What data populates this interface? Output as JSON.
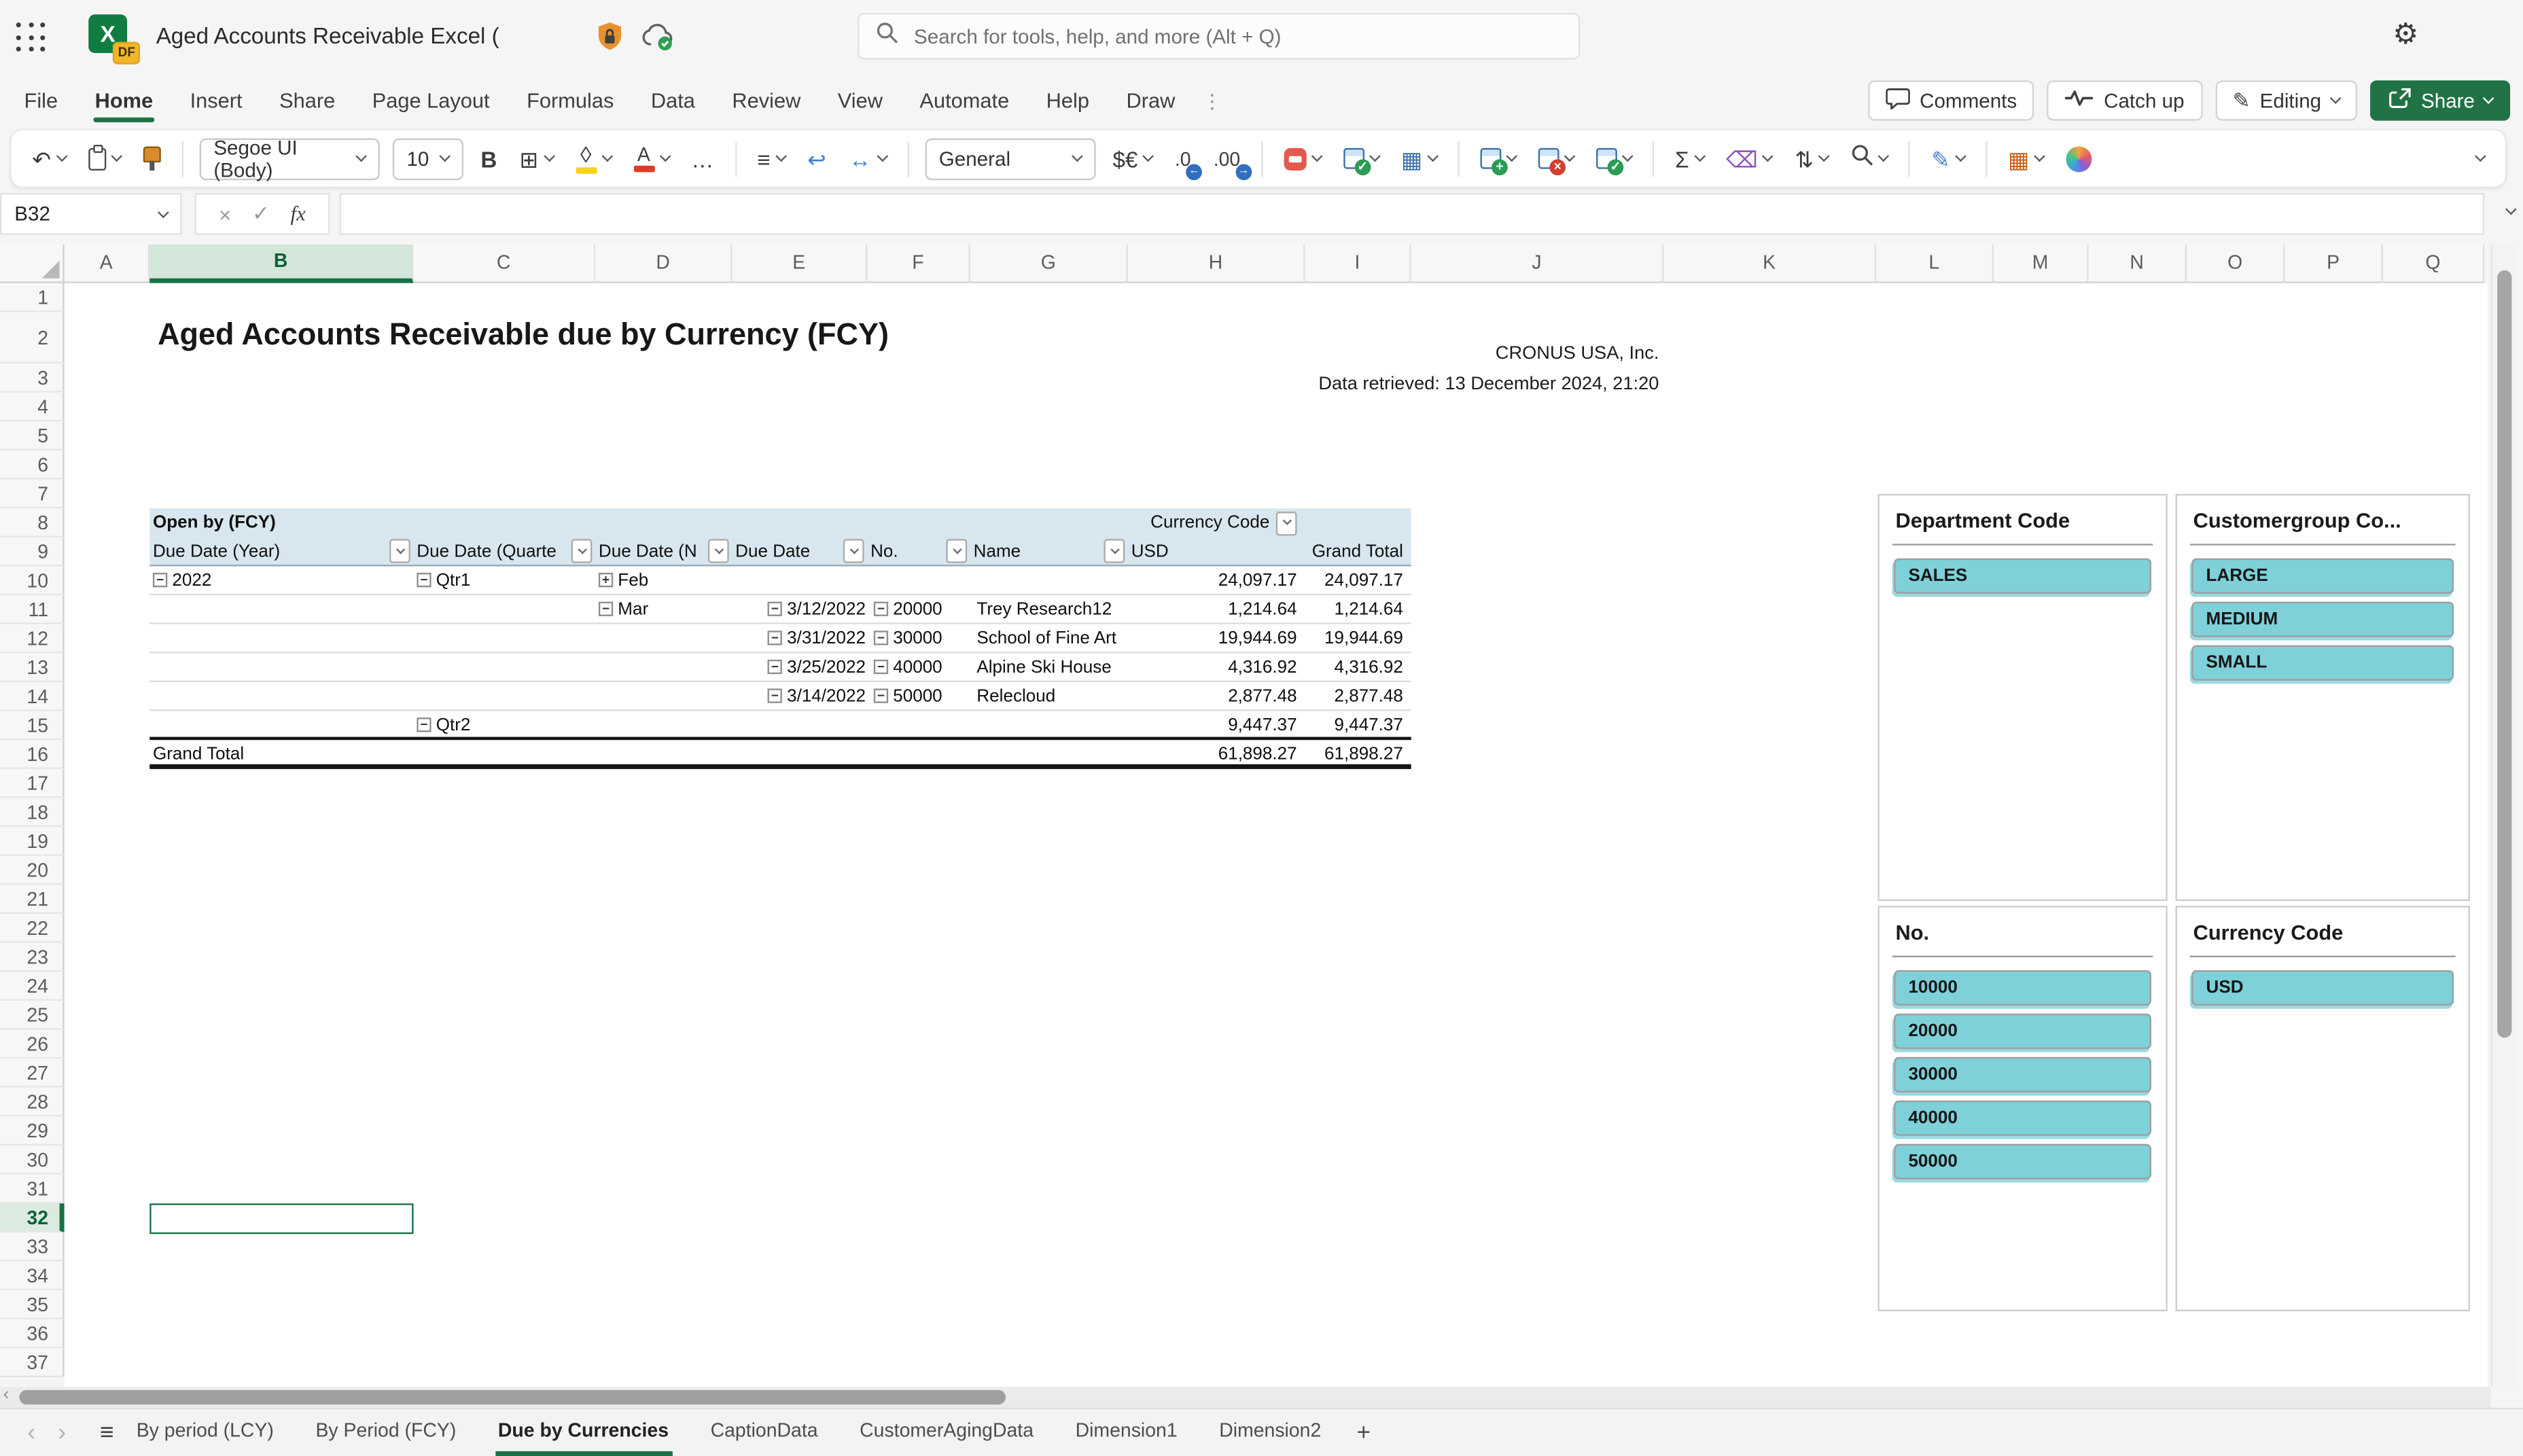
{
  "top_bar": {
    "title": "Aged Accounts Receivable Excel (",
    "file_badge": "DF",
    "search_placeholder": "Search for tools, help, and more (Alt + Q)"
  },
  "ribbon": {
    "tabs": [
      "File",
      "Home",
      "Insert",
      "Share",
      "Page Layout",
      "Formulas",
      "Data",
      "Review",
      "View",
      "Automate",
      "Help",
      "Draw"
    ],
    "active_tab": "Home",
    "comments_label": "Comments",
    "catch_up_label": "Catch up",
    "editing_label": "Editing",
    "share_label": "Share"
  },
  "toolbar": {
    "font_name": "Segoe UI (Body)",
    "font_size": "10",
    "number_format": "General"
  },
  "formula_bar": {
    "name_box": "B32",
    "formula": ""
  },
  "grid": {
    "columns": [
      "A",
      "B",
      "C",
      "D",
      "E",
      "F",
      "G",
      "H",
      "I",
      "J",
      "K",
      "L",
      "M",
      "N",
      "O",
      "P",
      "Q"
    ],
    "selected_column": "B",
    "row_count": 37,
    "selected_row": 32
  },
  "sheet": {
    "title": "Aged Accounts Receivable due by Currency (FCY)",
    "company": "CRONUS USA, Inc.",
    "retrieved": "Data retrieved: 13 December 2024, 21:20"
  },
  "pivot": {
    "title": "Open by (FCY)",
    "page_field": "Currency Code",
    "col_headers": [
      {
        "label": "Due Date (Year)",
        "dropdown": true
      },
      {
        "label": "Due Date (Quarte",
        "dropdown": true
      },
      {
        "label": "Due Date (N",
        "dropdown": true
      },
      {
        "label": "Due Date",
        "dropdown": true
      },
      {
        "label": "No.",
        "dropdown": true
      },
      {
        "label": "Name",
        "dropdown": true
      },
      {
        "label": "USD",
        "dropdown": false
      },
      {
        "label": "Grand Total",
        "dropdown": false
      }
    ],
    "rows": [
      {
        "b": "gray",
        "cells": [
          {
            "c": 0,
            "icon": "collapse",
            "t": "2022"
          },
          {
            "c": 1,
            "icon": "collapse",
            "t": "Qtr1"
          },
          {
            "c": 2,
            "icon": "expand",
            "t": "Feb"
          },
          {
            "c": 6,
            "t": "24,097.17",
            "a": "num"
          },
          {
            "c": 7,
            "t": "24,097.17",
            "a": "num"
          }
        ]
      },
      {
        "b": "gray",
        "cells": [
          {
            "c": 2,
            "icon": "collapse",
            "t": "Mar"
          },
          {
            "c": 3,
            "icon": "collapse",
            "t": "3/12/2022",
            "a": "r"
          },
          {
            "c": 4,
            "icon": "collapse",
            "t": "20000"
          },
          {
            "c": 5,
            "t": "Trey Research12"
          },
          {
            "c": 6,
            "t": "1,214.64",
            "a": "num"
          },
          {
            "c": 7,
            "t": "1,214.64",
            "a": "num"
          }
        ]
      },
      {
        "b": "gray",
        "cells": [
          {
            "c": 3,
            "icon": "collapse",
            "t": "3/31/2022",
            "a": "r"
          },
          {
            "c": 4,
            "icon": "collapse",
            "t": "30000"
          },
          {
            "c": 5,
            "t": "School of Fine Art"
          },
          {
            "c": 6,
            "t": "19,944.69",
            "a": "num"
          },
          {
            "c": 7,
            "t": "19,944.69",
            "a": "num"
          }
        ]
      },
      {
        "b": "gray",
        "cells": [
          {
            "c": 3,
            "icon": "collapse",
            "t": "3/25/2022",
            "a": "r"
          },
          {
            "c": 4,
            "icon": "collapse",
            "t": "40000"
          },
          {
            "c": 5,
            "t": "Alpine Ski House"
          },
          {
            "c": 6,
            "t": "4,316.92",
            "a": "num"
          },
          {
            "c": 7,
            "t": "4,316.92",
            "a": "num"
          }
        ]
      },
      {
        "b": "gray",
        "cells": [
          {
            "c": 3,
            "icon": "collapse",
            "t": "3/14/2022",
            "a": "r"
          },
          {
            "c": 4,
            "icon": "collapse",
            "t": "50000"
          },
          {
            "c": 5,
            "t": "Relecloud"
          },
          {
            "c": 6,
            "t": "2,877.48",
            "a": "num"
          },
          {
            "c": 7,
            "t": "2,877.48",
            "a": "num"
          }
        ]
      },
      {
        "b": "black",
        "cells": [
          {
            "c": 1,
            "icon": "collapse",
            "t": "Qtr2"
          },
          {
            "c": 6,
            "t": "9,447.37",
            "a": "num"
          },
          {
            "c": 7,
            "t": "9,447.37",
            "a": "num"
          }
        ]
      },
      {
        "b": "thick",
        "grand": true,
        "cells": [
          {
            "c": 0,
            "t": "Grand Total"
          },
          {
            "c": 6,
            "t": "61,898.27",
            "a": "num"
          },
          {
            "c": 7,
            "t": "61,898.27",
            "a": "num"
          }
        ]
      }
    ]
  },
  "slicers": [
    {
      "title": "Department Code",
      "items": [
        "SALES"
      ]
    },
    {
      "title": "Customergroup Co...",
      "items": [
        "LARGE",
        "MEDIUM",
        "SMALL"
      ]
    },
    {
      "title": "No.",
      "items": [
        "10000",
        "20000",
        "30000",
        "40000",
        "50000"
      ]
    },
    {
      "title": "Currency Code",
      "items": [
        "USD"
      ]
    }
  ],
  "sheet_tabs": {
    "tabs": [
      "By period (LCY)",
      "By Period (FCY)",
      "Due by Currencies",
      "CaptionData",
      "CustomerAgingData",
      "Dimension1",
      "Dimension2"
    ],
    "active": "Due by Currencies",
    "add_label": "+"
  },
  "icons": {
    "excel_x": "X",
    "gear": "⚙",
    "overflow": "⋮",
    "pencil": "✎",
    "undo": "↶",
    "bold": "B",
    "borders": "⊞",
    "fill_shape": "◊",
    "font_color_letter": "A",
    "ellipsis": "…",
    "align": "≡",
    "wrap": "↩",
    "merge": "↔",
    "currency": "$€",
    "decrease_decimal": ".0",
    "increase_decimal": ".00",
    "dec_arrow": "←",
    "inc_arrow": "→",
    "cell_styles": "▦",
    "autosum": "Σ",
    "clear": "⌫",
    "sort_filter": "⇅",
    "view_grid": "▦",
    "cancel": "×",
    "enter": "✓",
    "fx": "fx",
    "collapse": "−",
    "expand": "+",
    "hamburger": "≡",
    "prev": "‹",
    "next": "›"
  },
  "colors": {
    "accent_green": "#217346",
    "slicer_teal": "#7ED0D9",
    "pivot_header_blue": "#D8E7EF"
  }
}
